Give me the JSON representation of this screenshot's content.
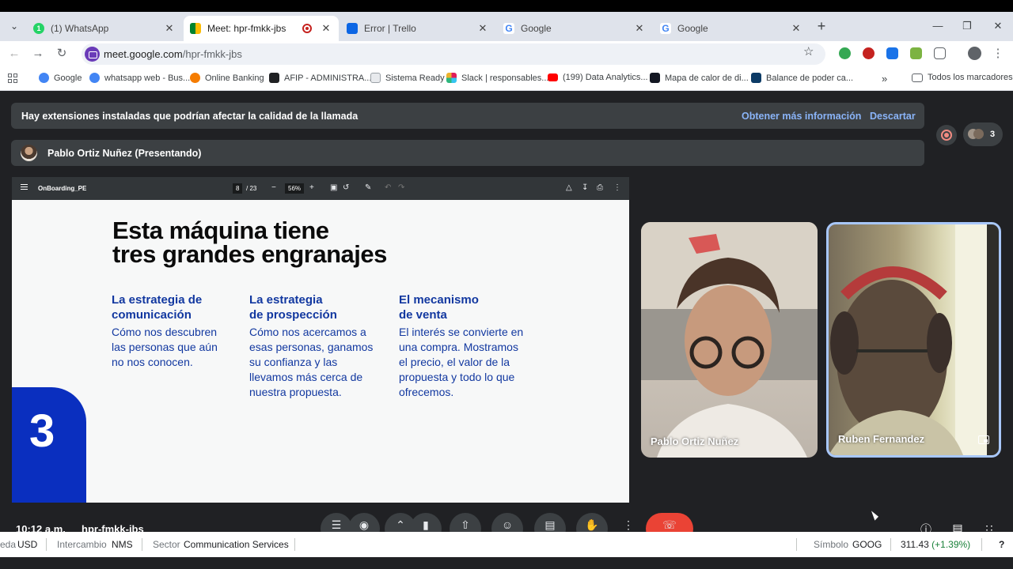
{
  "browser": {
    "tabs": [
      {
        "title": "(1) WhatsApp",
        "fav_color": "#25d366",
        "fav_text": "1"
      },
      {
        "title": "Meet: hpr-fmkk-jbs",
        "fav_color": "#00832d",
        "fav_text": ""
      },
      {
        "title": "Error | Trello",
        "fav_color": "#0c66e4",
        "fav_text": ""
      },
      {
        "title": "Google",
        "fav_color": "#4285f4",
        "fav_text": "G"
      },
      {
        "title": "Google",
        "fav_color": "#4285f4",
        "fav_text": "G"
      }
    ],
    "url_host": "meet.google.com",
    "url_path": "/hpr-fmkk-jbs",
    "bookmarks": [
      {
        "label": "Google",
        "color": "#4285f4"
      },
      {
        "label": "whatsapp web - Bus...",
        "color": "#4285f4"
      },
      {
        "label": "Online Banking",
        "color": "#f57c00"
      },
      {
        "label": "AFIP - ADMINISTRA...",
        "color": "#202124"
      },
      {
        "label": "Sistema Ready",
        "color": "#9aa0a6"
      },
      {
        "label": "Slack | responsables...",
        "color": "#e01e5a"
      },
      {
        "label": "(199) Data Analytics...",
        "color": "#ff0000"
      },
      {
        "label": "Mapa de calor de di...",
        "color": "#131722"
      },
      {
        "label": "Balance de poder ca...",
        "color": "#0d3b66"
      }
    ],
    "all_bookmarks": "Todos los marcadores"
  },
  "meet": {
    "banner_message": "Hay extensiones instaladas que podrían afectar la calidad de la llamada",
    "banner_more": "Obtener más información",
    "banner_dismiss": "Descartar",
    "presenter": "Pablo Ortiz Nuñez (Presentando)",
    "participant_count": "3",
    "time": "10:12 a.m.",
    "meeting_code": "hpr-fmkk-jbs",
    "tiles": [
      {
        "name": "Pablo Ortiz Nuñez"
      },
      {
        "name": "Ruben Fernandez"
      }
    ]
  },
  "pdf": {
    "filename": "OnBoarding_PE",
    "page": "8",
    "total": "/ 23",
    "zoom": "56%",
    "slide": {
      "title_line1": "Esta máquina tiene",
      "title_line2": "tres grandes engranajes",
      "columns": [
        {
          "heading": "La estrategia de\ncomunicación",
          "body": "Cómo nos descubren\nlas personas que aún\nno nos conocen."
        },
        {
          "heading": "La estrategia\nde prospección",
          "body": "Cómo nos acercamos a\nesas personas, ganamos\nsu confianza y las\nllevamos más cerca de\nnuestra propuesta."
        },
        {
          "heading": "El mecanismo\nde venta",
          "body": "El interés se convierte en\nuna compra. Mostramos\nel precio, el valor de la\npropuesta y todo lo que\nofrecemos."
        }
      ],
      "number": "3"
    }
  },
  "stock": {
    "currency_label": "eda",
    "currency": "USD",
    "exchange_label": "Intercambio",
    "exchange": "NMS",
    "sector_label": "Sector",
    "sector": "Communication Services",
    "symbol_label": "Símbolo",
    "symbol": "GOOG",
    "price": "311.43",
    "change": "(+1.39%)",
    "help": "?"
  }
}
